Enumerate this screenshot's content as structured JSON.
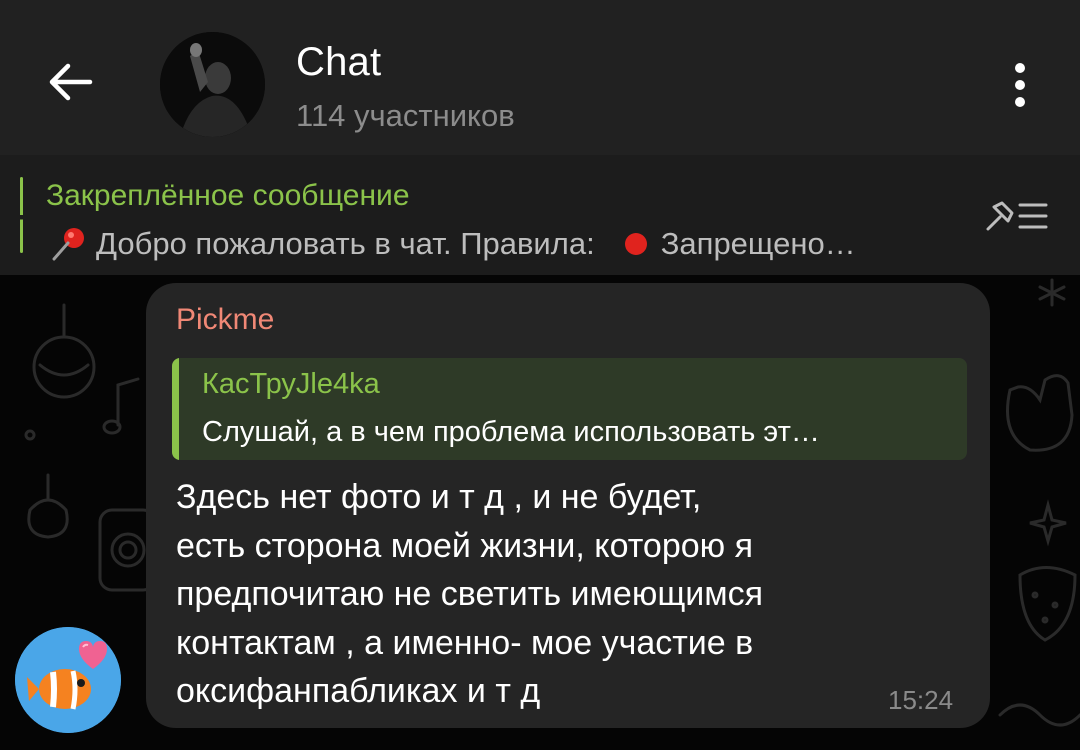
{
  "header": {
    "title": "Chat",
    "subtitle": "114 участников",
    "icons": {
      "back": "arrow-left-icon",
      "menu": "more-vertical-icon"
    },
    "colors": {
      "background": "#212121",
      "title": "#ffffff",
      "subtitle": "#8c8c8c"
    }
  },
  "pinned": {
    "title": "Закреплённое сообщение",
    "text_start": "Добро пожаловать в чат. Правила:",
    "text_end": "Запрещено…",
    "icons": {
      "pin": "pushpin-icon",
      "list": "pinned-list-icon",
      "dot": "red-circle-icon"
    },
    "colors": {
      "accent": "#8bc34a",
      "dot": "#e0231e"
    }
  },
  "message": {
    "sender": "Pickme",
    "reply": {
      "name": "КасТруJle4ka",
      "text": "Слушай, а в чем проблема использовать эт…"
    },
    "text": "Здесь нет фото и т д , и не будет,\nесть сторона моей жизни, которою я\nпредпочитаю не светить имеющимся\nконтактам , а именно- мое участие в\nоксифанпабликах и т д",
    "time": "15:24",
    "colors": {
      "sender": "#f08876",
      "bubble": "#252525",
      "reply_bg": "#2e3a27"
    }
  },
  "sender_avatar": {
    "icon": "clownfish-heart-avatar-icon",
    "color": "#4aa6e8"
  }
}
